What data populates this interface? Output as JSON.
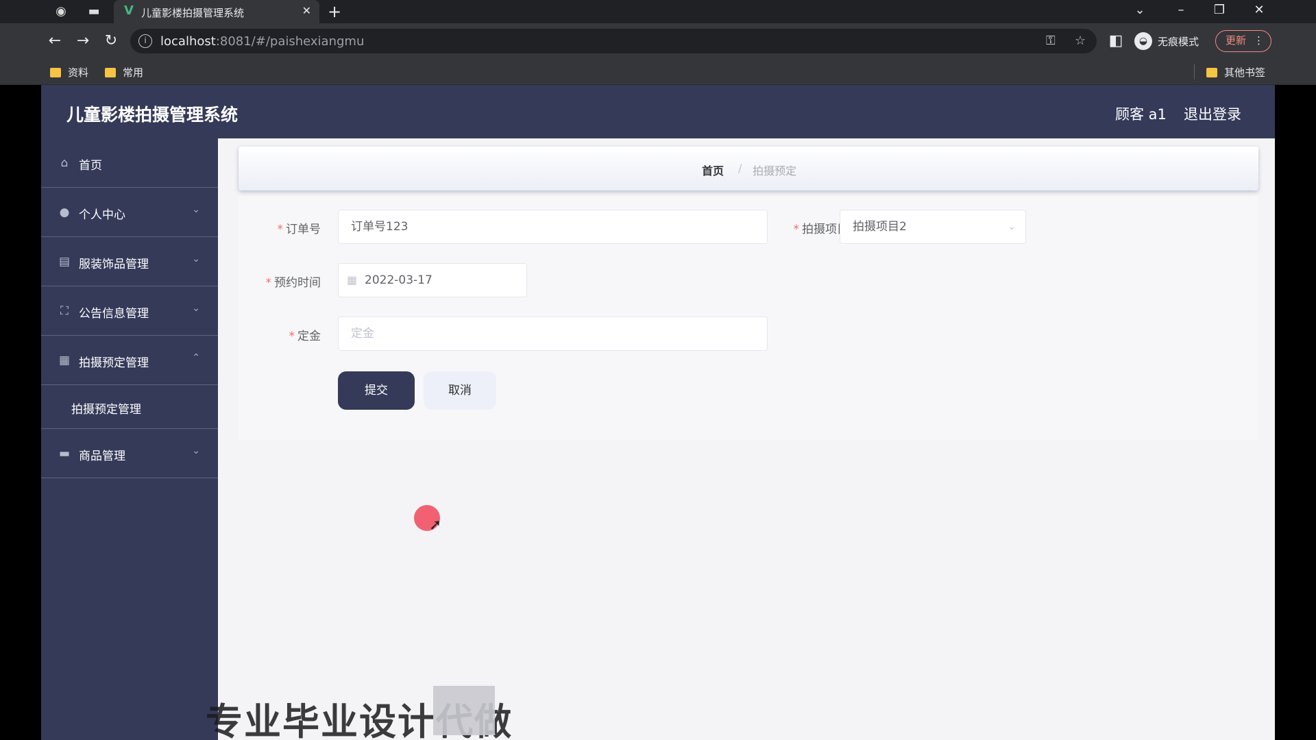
{
  "browser": {
    "tab_title": "儿童影楼拍摄管理系统",
    "url_host": "localhost",
    "url_rest": ":8081/#/paishexiangmu",
    "incognito_label": "无痕模式",
    "update_label": "更新",
    "bookmarks": [
      "资料",
      "常用"
    ],
    "other_bookmarks": "其他书签"
  },
  "app": {
    "title": "儿童影楼拍摄管理系统",
    "user": "顾客 a1",
    "logout": "退出登录"
  },
  "sidebar": {
    "items": [
      {
        "label": "首页",
        "icon": "home-icon"
      },
      {
        "label": "个人中心",
        "icon": "user-icon"
      },
      {
        "label": "服装饰品管理",
        "icon": "clipboard-icon"
      },
      {
        "label": "公告信息管理",
        "icon": "announcement-icon"
      },
      {
        "label": "拍摄预定管理",
        "icon": "grid-icon",
        "expanded": true
      },
      {
        "label": "商品管理",
        "icon": "goods-icon"
      }
    ],
    "submenu": {
      "label": "拍摄预定管理"
    }
  },
  "breadcrumb": {
    "home": "首页",
    "separator": "/",
    "current": "拍摄预定"
  },
  "form": {
    "order_no": {
      "label": "订单号",
      "value": "订单号123"
    },
    "project": {
      "label": "拍摄项目",
      "value": "拍摄项目2"
    },
    "reserve_time": {
      "label": "预约时间",
      "value": "2022-03-17"
    },
    "deposit": {
      "label": "定金",
      "placeholder": "定金"
    },
    "submit": "提交",
    "cancel": "取消"
  },
  "watermark": "专业毕业设计代做"
}
